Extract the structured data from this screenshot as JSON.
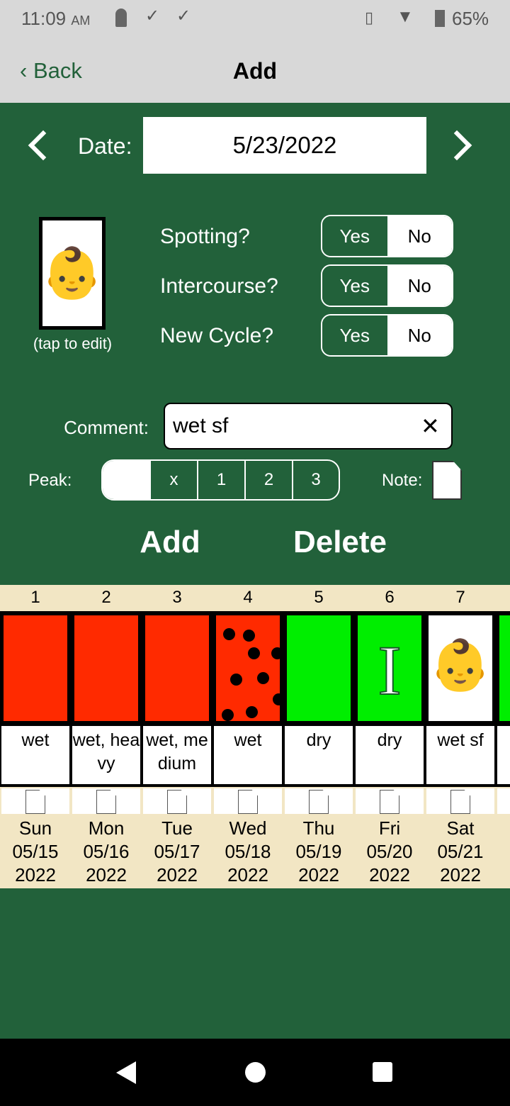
{
  "status": {
    "time": "11:09",
    "ampm": "AM",
    "battery": "65%"
  },
  "nav": {
    "back": "Back",
    "title": "Add"
  },
  "date": {
    "label": "Date:",
    "value": "5/23/2022"
  },
  "photo": {
    "caption": "(tap to edit)"
  },
  "questions": [
    {
      "label": "Spotting?",
      "yes": "Yes",
      "no": "No"
    },
    {
      "label": "Intercourse?",
      "yes": "Yes",
      "no": "No"
    },
    {
      "label": "New Cycle?",
      "yes": "Yes",
      "no": "No"
    }
  ],
  "comment": {
    "label": "Comment:",
    "value": "wet sf"
  },
  "peak": {
    "label": "Peak:",
    "options": [
      "",
      "x",
      "1",
      "2",
      "3"
    ],
    "selected": 0
  },
  "note": {
    "label": "Note:"
  },
  "actions": {
    "add": "Add",
    "delete": "Delete"
  },
  "colors": {
    "green_bg": "#22613a",
    "red": "#ff2a00",
    "bright_green": "#00ee00",
    "beige": "#f2e6c4"
  },
  "days": [
    {
      "num": "1",
      "stamp": "red",
      "text": "wet",
      "dow": "Sun",
      "date": "05/15",
      "year": "2022"
    },
    {
      "num": "2",
      "stamp": "red",
      "text": "wet, heavy",
      "dow": "Mon",
      "date": "05/16",
      "year": "2022"
    },
    {
      "num": "3",
      "stamp": "red",
      "text": "wet, medium",
      "dow": "Tue",
      "date": "05/17",
      "year": "2022"
    },
    {
      "num": "4",
      "stamp": "red-dots",
      "text": "wet",
      "dow": "Wed",
      "date": "05/18",
      "year": "2022"
    },
    {
      "num": "5",
      "stamp": "green",
      "text": "dry",
      "dow": "Thu",
      "date": "05/19",
      "year": "2022"
    },
    {
      "num": "6",
      "stamp": "green-I",
      "text": "dry",
      "dow": "Fri",
      "date": "05/20",
      "year": "2022"
    },
    {
      "num": "7",
      "stamp": "baby",
      "text": "wet sf",
      "dow": "Sat",
      "date": "05/21",
      "year": "2022"
    }
  ]
}
